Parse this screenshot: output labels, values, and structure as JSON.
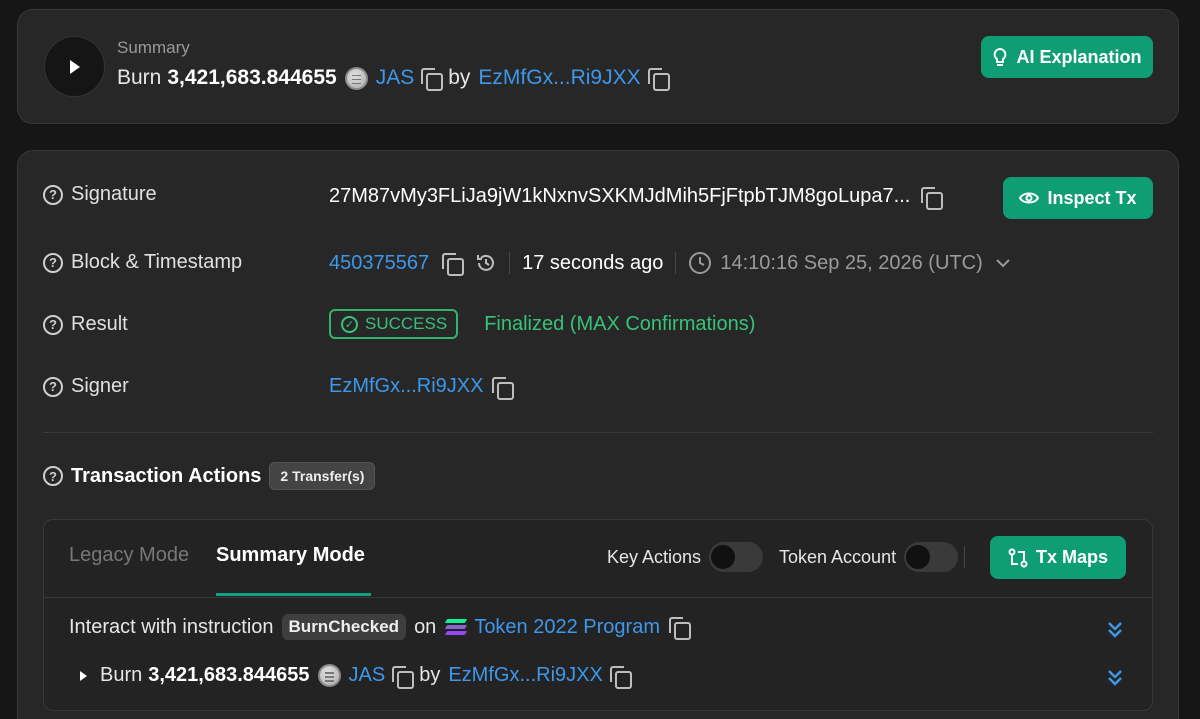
{
  "summary": {
    "label": "Summary",
    "action": "Burn",
    "amount": "3,421,683.844655",
    "token": "JAS",
    "by": "by",
    "signer": "EzMfGx...Ri9JXX",
    "ai_button": "AI Explanation"
  },
  "details": {
    "signature_label": "Signature",
    "signature": "27M87vMy3FLiJa9jW1kNxnvSXKMJdMih5FjFtpbTJM8goLupa7...",
    "inspect_button": "Inspect Tx",
    "block_label": "Block & Timestamp",
    "block": "450375567",
    "age": "17 seconds ago",
    "timestamp": "14:10:16 Sep 25, 2026 (UTC)",
    "result_label": "Result",
    "status": "SUCCESS",
    "finality": "Finalized (MAX Confirmations)",
    "signer_label": "Signer",
    "signer": "EzMfGx...Ri9JXX"
  },
  "actions": {
    "title": "Transaction Actions",
    "badge": "2 Transfer(s)",
    "tabs": [
      "Legacy Mode",
      "Summary Mode"
    ],
    "key_actions_label": "Key Actions",
    "token_account_label": "Token Account",
    "tx_maps_button": "Tx Maps",
    "instruction_prefix": "Interact with instruction",
    "instruction": "BurnChecked",
    "on": "on",
    "program": "Token 2022 Program",
    "sub_action": "Burn",
    "sub_amount": "3,421,683.844655",
    "sub_token": "JAS",
    "sub_by": "by",
    "sub_signer": "EzMfGx...Ri9JXX"
  },
  "colors": {
    "accent": "#0f9d74",
    "link": "#3d97ea",
    "success": "#36c27a",
    "background": "#161616",
    "card": "#272727"
  }
}
